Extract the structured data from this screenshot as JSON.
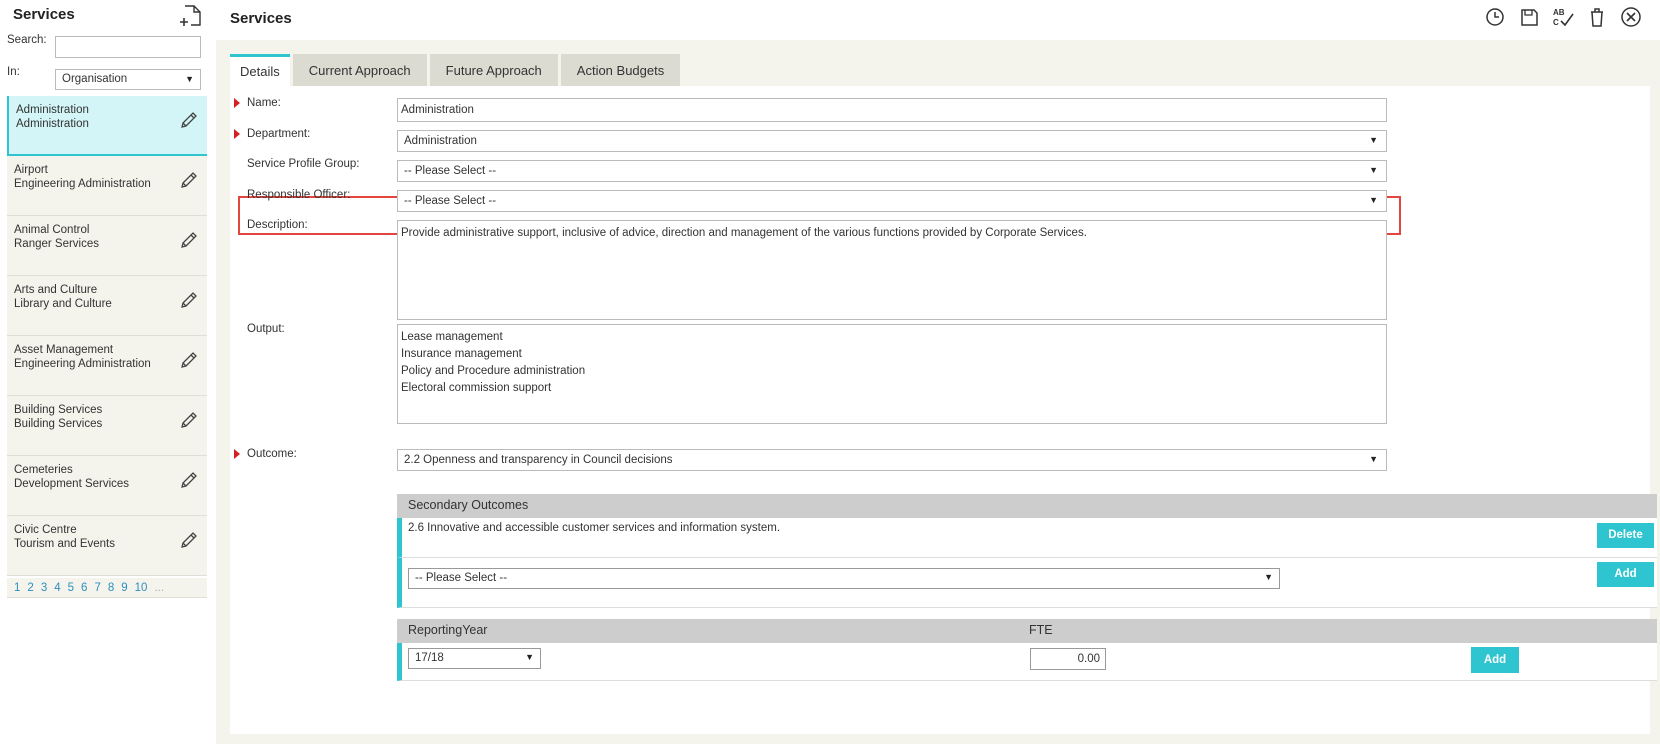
{
  "sidebar": {
    "title": "Services",
    "search_label": "Search:",
    "search_value": "",
    "in_label": "In:",
    "in_value": "Organisation",
    "items": [
      {
        "line1": "Administration",
        "line2": "Administration"
      },
      {
        "line1": "Airport",
        "line2": "Engineering Administration"
      },
      {
        "line1": "Animal Control",
        "line2": "Ranger Services"
      },
      {
        "line1": "Arts and Culture",
        "line2": "Library and Culture"
      },
      {
        "line1": "Asset Management",
        "line2": "Engineering Administration"
      },
      {
        "line1": "Building Services",
        "line2": "Building Services"
      },
      {
        "line1": "Cemeteries",
        "line2": "Development Services"
      },
      {
        "line1": "Civic Centre",
        "line2": "Tourism and Events"
      }
    ],
    "pages": [
      "1",
      "2",
      "3",
      "4",
      "5",
      "6",
      "7",
      "8",
      "9",
      "10",
      "..."
    ]
  },
  "main": {
    "title": "Services",
    "toolbar": [
      "history-icon",
      "save-icon",
      "spellcheck-icon",
      "delete-icon",
      "close-icon"
    ],
    "tabs": [
      "Details",
      "Current Approach",
      "Future Approach",
      "Action Budgets"
    ],
    "form": {
      "name_label": "Name:",
      "name_value": "Administration",
      "department_label": "Department:",
      "department_value": "Administration",
      "spg_label": "Service Profile Group:",
      "spg_value": "-- Please Select --",
      "officer_label": "Responsible Officer:",
      "officer_value": "-- Please Select --",
      "description_label": "Description:",
      "description_value": "Provide administrative support, inclusive of advice, direction and management of the various functions provided by Corporate Services.",
      "output_label": "Output:",
      "output_lines": [
        "Lease management",
        "Insurance management",
        "Policy and Procedure administration",
        "Electoral commission support"
      ],
      "outcome_label": "Outcome:",
      "outcome_value": "2.2 Openness and transparency in Council decisions"
    },
    "secondary_outcomes": {
      "header": "Secondary Outcomes",
      "row_text": "2.6 Innovative and accessible customer services and information system.",
      "delete_label": "Delete",
      "select_value": "-- Please Select --",
      "add_label": "Add"
    },
    "reporting": {
      "col1": "ReportingYear",
      "col2": "FTE",
      "year_value": "17/18",
      "fte_value": "0.00",
      "add_label": "Add"
    }
  },
  "colors": {
    "accent": "#2ec4d0",
    "highlight": "#e2463e",
    "required": "#d62020",
    "panel_bg": "#f4f3ec"
  }
}
